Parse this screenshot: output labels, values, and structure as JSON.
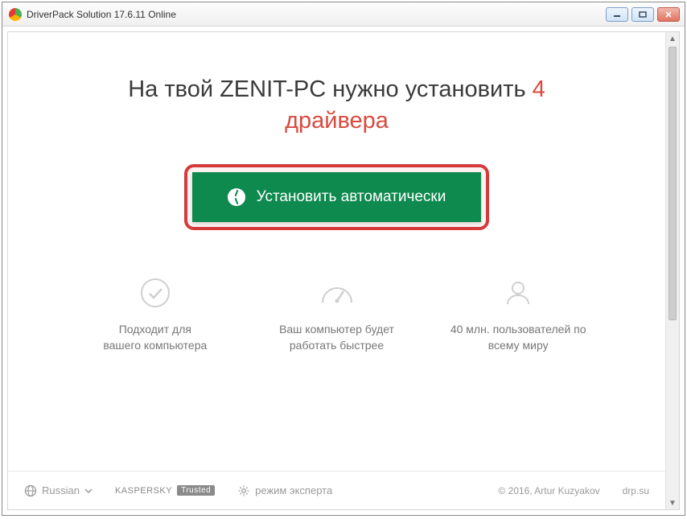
{
  "window": {
    "title": "DriverPack Solution 17.6.11 Online"
  },
  "headline": {
    "part1": "На твой ZENIT-PC нужно установить ",
    "count": "4",
    "part2": "драйвера"
  },
  "cta": {
    "label": "Установить автоматически"
  },
  "features": [
    {
      "icon": "check",
      "text_line1": "Подходит для",
      "text_line2": "вашего компьютера"
    },
    {
      "icon": "gauge",
      "text_line1": "Ваш компьютер будет",
      "text_line2": "работать быстрее"
    },
    {
      "icon": "user",
      "text_line1": "40 млн. пользователей по",
      "text_line2": "всему миру"
    }
  ],
  "footer": {
    "language": "Russian",
    "kaspersky_label": "KASPERSKY",
    "trusted": "Trusted",
    "expert_mode": "режим эксперта",
    "copyright": "© 2016, Artur Kuzyakov",
    "site": "drp.su"
  }
}
